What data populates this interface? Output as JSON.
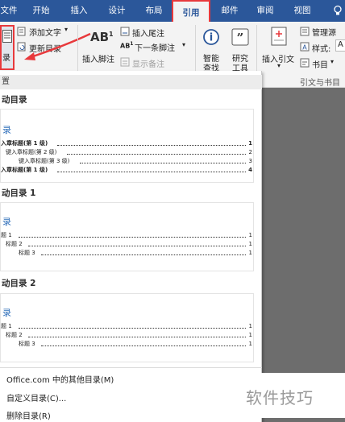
{
  "tabs": [
    "文件",
    "开始",
    "插入",
    "设计",
    "布局",
    "引用",
    "邮件",
    "审阅",
    "视图"
  ],
  "active_tab": "引用",
  "ribbon": {
    "toc_button": "录",
    "add_text": "添加文字",
    "update_toc": "更新目录",
    "insert_footnote": "插入脚注",
    "insert_endnote": "插入尾注",
    "next_footnote": "下一条脚注",
    "show_notes": "显示备注",
    "smart_lookup_1": "智能",
    "smart_lookup_2": "查找",
    "research_1": "研究",
    "research_2": "工具",
    "insert_citation": "插入引文",
    "manage_sources": "管理源",
    "style_label": "样式:",
    "style_value": "A",
    "bibliography": "书目",
    "group_citations": "引文与书目"
  },
  "dropdown": {
    "builtin_header": "置",
    "auto_toc_1_title_top": "动目录",
    "preview1": {
      "heading": "录",
      "lines": [
        {
          "label": "入章标题(第 1 级)",
          "page": "1"
        },
        {
          "label": "键入章标题(第 2 级)",
          "page": "2"
        },
        {
          "label": "键入章标题(第 3 级)",
          "page": "3"
        },
        {
          "label": "入章标题(第 1 级)",
          "page": "4"
        }
      ]
    },
    "auto_toc_1_title": "动目录 1",
    "preview2": {
      "heading": "录",
      "lines": [
        {
          "label": "题 1",
          "page": "1"
        },
        {
          "label": "标题 2",
          "page": "1"
        },
        {
          "label": "标题 3",
          "page": "1"
        }
      ]
    },
    "auto_toc_2_title": "动目录 2",
    "preview3": {
      "heading": "录",
      "lines": [
        {
          "label": "题 1",
          "page": "1"
        },
        {
          "label": "标题 2",
          "page": "1"
        },
        {
          "label": "标题 3",
          "page": "1"
        }
      ]
    },
    "menu": {
      "more_toc": "Office.com 中的其他目录(M)",
      "custom_toc": "自定义目录(C)...",
      "remove_toc": "删除目录(R)"
    }
  },
  "watermark": "软件技巧",
  "colors": {
    "ribbon_blue": "#2b579a",
    "highlight_red": "#e8393c",
    "toc_heading_blue": "#2f6fba"
  }
}
